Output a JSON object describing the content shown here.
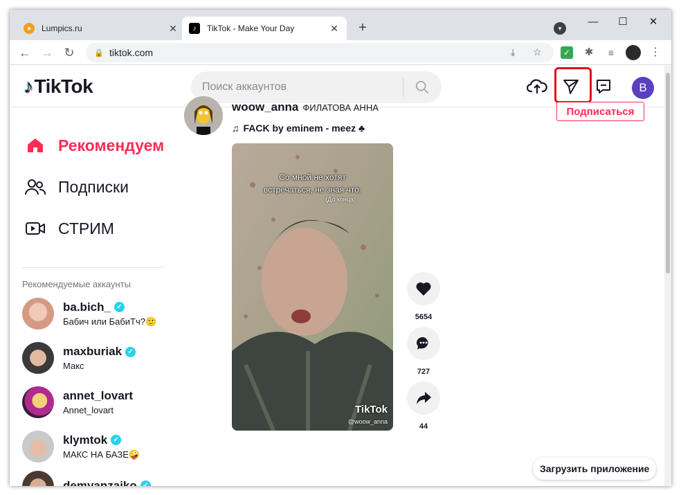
{
  "browser": {
    "tabs": [
      {
        "title": "Lumpics.ru",
        "favicon": "lumpics-icon",
        "active": false
      },
      {
        "title": "TikTok - Make Your Day",
        "favicon": "tiktok-icon",
        "active": true
      }
    ],
    "url": "tiktok.com"
  },
  "header": {
    "logo_text": "TikTok",
    "search_placeholder": "Поиск аккаунтов",
    "avatar_letter": "B"
  },
  "sidebar": {
    "nav": [
      {
        "label": "Рекомендуем",
        "icon": "home-icon",
        "active": true
      },
      {
        "label": "Подписки",
        "icon": "users-icon",
        "active": false
      },
      {
        "label": "СТРИМ",
        "icon": "live-icon",
        "active": false
      }
    ],
    "suggested_caption": "Рекомендуемые аккаунты",
    "accounts": [
      {
        "username": "ba.bich_",
        "display": "Бабич или БабиТч?🙂"
      },
      {
        "username": "maxburiak",
        "display": "Макс"
      },
      {
        "username": "annet_lovart",
        "display": "Annet_lovart"
      },
      {
        "username": "klymtok",
        "display": "МАКС НА БАЗЕ🤪"
      },
      {
        "username": "demyanzaiko",
        "display": ""
      }
    ]
  },
  "post": {
    "username": "woow_anna",
    "nickname": "ФИЛАТОВА АННА",
    "music": "FACK by eminem - meez ♣",
    "follow_label": "Подписаться",
    "video_caption": "Со мной не хотят\nвстречаться, не зная что:",
    "video_subcaption": "(До конца)",
    "watermark": "TikTok",
    "watermark_user": "@woow_anna",
    "likes": "5654",
    "comments": "727",
    "shares": "44"
  },
  "get_app_label": "Загрузить приложение",
  "colors": {
    "brand_red": "#fe2c55",
    "highlight": "#e0101a",
    "avatar_bg": "#5a3fc0",
    "verified": "#20d5ec"
  }
}
